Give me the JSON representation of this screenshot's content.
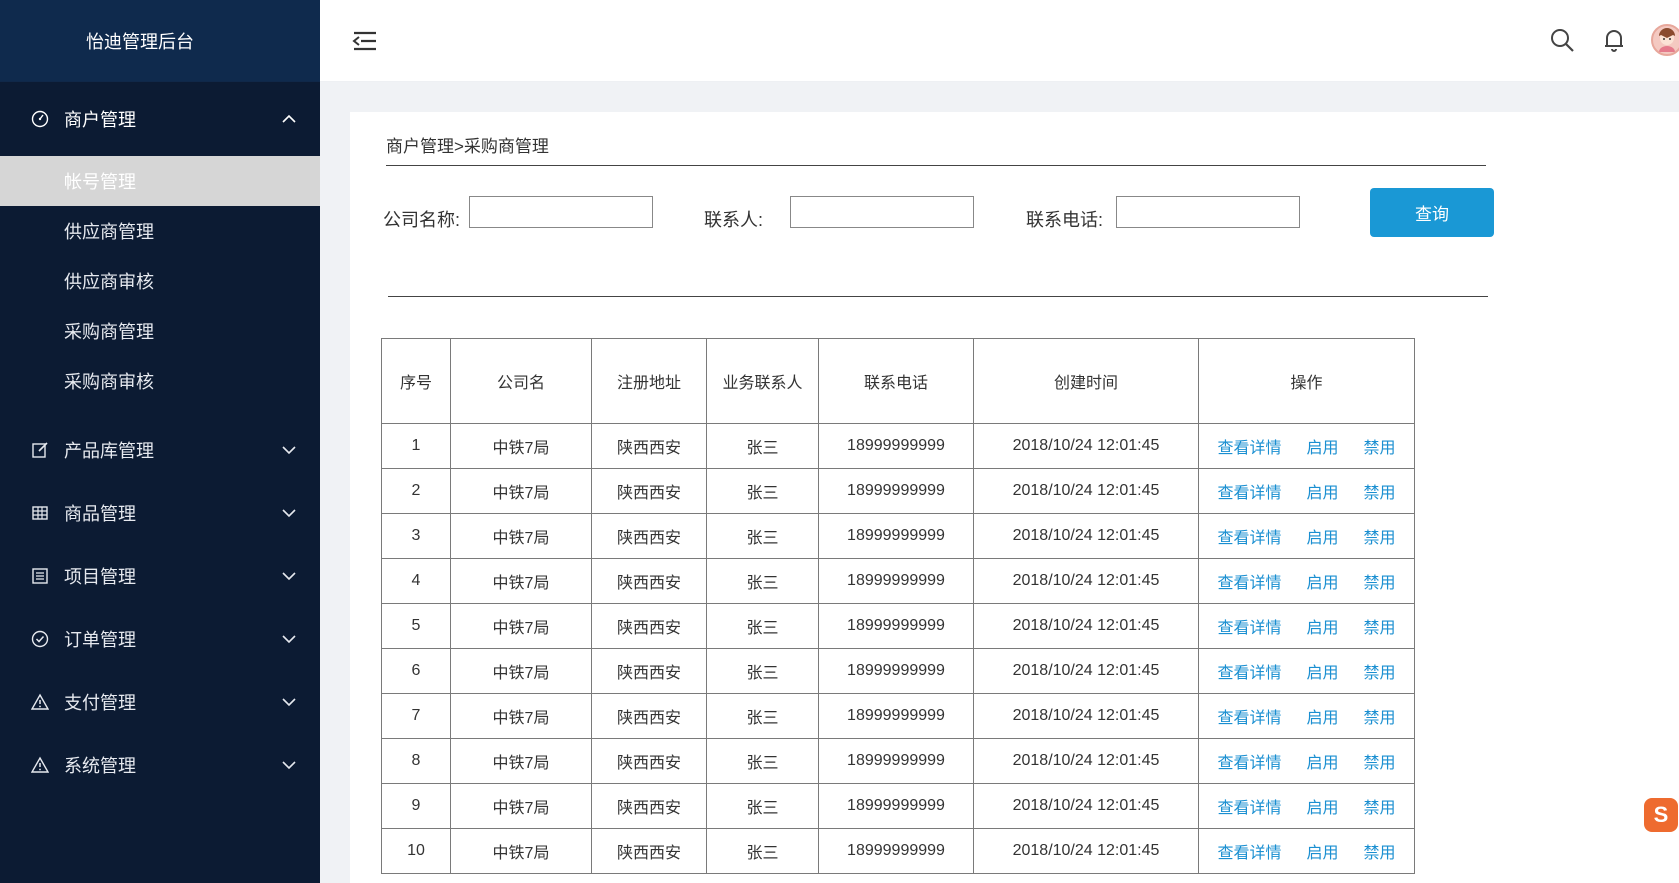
{
  "app": {
    "title": "怡迪管理后台"
  },
  "sidebar": {
    "merchant": {
      "label": "商户管理",
      "icon": "dashboard-icon",
      "items": [
        {
          "label": "帐号管理",
          "active": true
        },
        {
          "label": "供应商管理",
          "active": false
        },
        {
          "label": "供应商审核",
          "active": false
        },
        {
          "label": "采购商管理",
          "active": false
        },
        {
          "label": "采购商审核",
          "active": false
        }
      ]
    },
    "menus": [
      {
        "label": "产品库管理",
        "icon": "edit-icon"
      },
      {
        "label": "商品管理",
        "icon": "table-icon"
      },
      {
        "label": "项目管理",
        "icon": "list-icon"
      },
      {
        "label": "订单管理",
        "icon": "check-circle-icon"
      },
      {
        "label": "支付管理",
        "icon": "warning-icon"
      },
      {
        "label": "系统管理",
        "icon": "warning-icon"
      }
    ]
  },
  "header": {
    "icons": [
      "menu-fold-icon",
      "search-icon",
      "bell-icon",
      "avatar"
    ]
  },
  "main": {
    "breadcrumb": "商户管理>采购商管理",
    "filters": {
      "company_label": "公司名称:",
      "contact_label": "联系人:",
      "phone_label": "联系电话:",
      "company_value": "",
      "contact_value": "",
      "phone_value": "",
      "query_button": "查询"
    },
    "table": {
      "headers": [
        "序号",
        "公司名",
        "注册地址",
        "业务联系人",
        "联系电话",
        "创建时间",
        "操作"
      ],
      "actions": [
        "查看详情",
        "启用",
        "禁用"
      ],
      "rows": [
        [
          "1",
          "中铁7局",
          "陕西西安",
          "张三",
          "18999999999",
          "2018/10/24 12:01:45"
        ],
        [
          "2",
          "中铁7局",
          "陕西西安",
          "张三",
          "18999999999",
          "2018/10/24 12:01:45"
        ],
        [
          "3",
          "中铁7局",
          "陕西西安",
          "张三",
          "18999999999",
          "2018/10/24 12:01:45"
        ],
        [
          "4",
          "中铁7局",
          "陕西西安",
          "张三",
          "18999999999",
          "2018/10/24 12:01:45"
        ],
        [
          "5",
          "中铁7局",
          "陕西西安",
          "张三",
          "18999999999",
          "2018/10/24 12:01:45"
        ],
        [
          "6",
          "中铁7局",
          "陕西西安",
          "张三",
          "18999999999",
          "2018/10/24 12:01:45"
        ],
        [
          "7",
          "中铁7局",
          "陕西西安",
          "张三",
          "18999999999",
          "2018/10/24 12:01:45"
        ],
        [
          "8",
          "中铁7局",
          "陕西西安",
          "张三",
          "18999999999",
          "2018/10/24 12:01:45"
        ],
        [
          "9",
          "中铁7局",
          "陕西西安",
          "张三",
          "18999999999",
          "2018/10/24 12:01:45"
        ],
        [
          "10",
          "中铁7局",
          "陕西西安",
          "张三",
          "18999999999",
          "2018/10/24 12:01:45"
        ]
      ]
    }
  },
  "badge": {
    "letter": "S"
  },
  "colors": {
    "sidebar_bg": "#0c1b33",
    "brand_bg": "#0f2a4d",
    "accent": "#1a98d5",
    "link": "#1a8fd1",
    "active_item": "#d6d6d6"
  }
}
